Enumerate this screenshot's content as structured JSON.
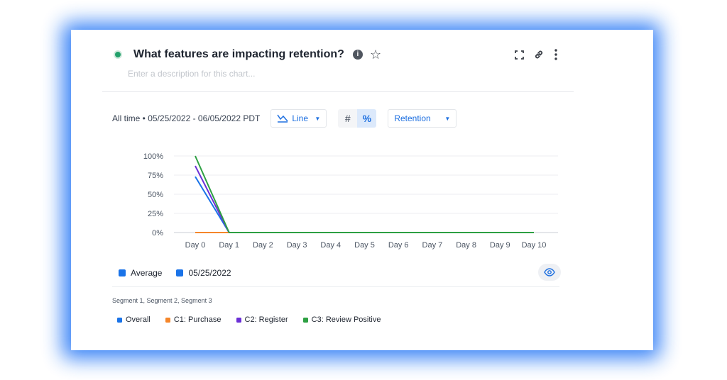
{
  "header": {
    "title": "What features are impacting retention?",
    "info_icon": "i",
    "star_icon": "☆",
    "description_placeholder": "Enter a description for this chart..."
  },
  "toolbar_icons": [
    "expand-icon",
    "link-icon",
    "more-vertical-icon"
  ],
  "controls": {
    "date_range": "All time • 05/25/2022 - 06/05/2022 PDT",
    "chart_type_label": "Line",
    "number_toggle": "#",
    "percent_toggle": "%",
    "percent_active": true,
    "metric_label": "Retention"
  },
  "colors": {
    "accent": "#1d6fe0",
    "status": "#22a06b",
    "overall": "#1a73e8",
    "purchase": "#f5862a",
    "register": "#6b2fd6",
    "review_positive": "#2ea043"
  },
  "chart_data": {
    "type": "line",
    "categories": [
      "Day 0",
      "Day 1",
      "Day 2",
      "Day 3",
      "Day 4",
      "Day 5",
      "Day 6",
      "Day 7",
      "Day 8",
      "Day 9",
      "Day 10"
    ],
    "y_ticks": [
      "100%",
      "75%",
      "50%",
      "25%",
      "0%"
    ],
    "ylim": [
      0,
      100
    ],
    "grid": true,
    "series": [
      {
        "name": "Overall",
        "color": "#1a73e8",
        "values": [
          73,
          0,
          0,
          0,
          0,
          0,
          0,
          0,
          0,
          0,
          0
        ]
      },
      {
        "name": "C1: Purchase",
        "color": "#f5862a",
        "values": [
          0,
          0,
          0,
          0,
          0,
          0,
          0,
          0,
          0,
          0,
          0
        ]
      },
      {
        "name": "C2: Register",
        "color": "#6b2fd6",
        "values": [
          87,
          0,
          0,
          0,
          0,
          0,
          0,
          0,
          0,
          0,
          0
        ]
      },
      {
        "name": "C3: Review Positive",
        "color": "#2ea043",
        "values": [
          100,
          0,
          0,
          0,
          0,
          0,
          0,
          0,
          0,
          0,
          0
        ]
      }
    ]
  },
  "legend_top": [
    {
      "label": "Average",
      "color": "#1a73e8"
    },
    {
      "label": "05/25/2022",
      "color": "#1a73e8"
    }
  ],
  "segments": {
    "title": "Segment 1, Segment 2, Segment 3",
    "items": [
      {
        "label": "Overall",
        "color": "#1a73e8"
      },
      {
        "label": "C1: Purchase",
        "color": "#f5862a"
      },
      {
        "label": "C2: Register",
        "color": "#6b2fd6"
      },
      {
        "label": "C3: Review Positive",
        "color": "#2ea043"
      }
    ]
  }
}
